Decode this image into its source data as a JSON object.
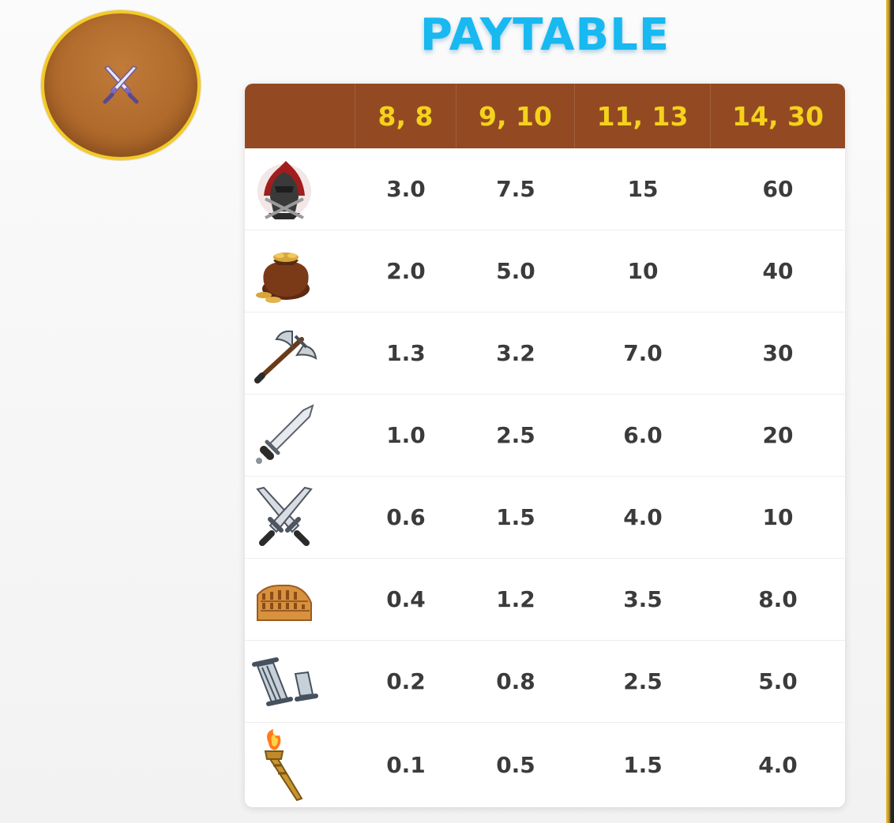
{
  "title": "PAYTABLE",
  "button": {
    "icon": "crossed-swords-icon"
  },
  "table": {
    "headers": [
      "8, 8",
      "9, 10",
      "11, 13",
      "14, 30"
    ],
    "rows": [
      {
        "symbol": "gladiator-helmet-icon",
        "values": [
          "3.0",
          "7.5",
          "15",
          "60"
        ]
      },
      {
        "symbol": "gold-coin-bag-icon",
        "values": [
          "2.0",
          "5.0",
          "10",
          "40"
        ]
      },
      {
        "symbol": "battle-axe-icon",
        "values": [
          "1.3",
          "3.2",
          "7.0",
          "30"
        ]
      },
      {
        "symbol": "sword-icon",
        "values": [
          "1.0",
          "2.5",
          "6.0",
          "20"
        ]
      },
      {
        "symbol": "crossed-swords-icon",
        "values": [
          "0.6",
          "1.5",
          "4.0",
          "10"
        ]
      },
      {
        "symbol": "colosseum-icon",
        "values": [
          "0.4",
          "1.2",
          "3.5",
          "8.0"
        ]
      },
      {
        "symbol": "broken-columns-icon",
        "values": [
          "0.2",
          "0.8",
          "2.5",
          "5.0"
        ]
      },
      {
        "symbol": "torch-icon",
        "values": [
          "0.1",
          "0.5",
          "1.5",
          "4.0"
        ]
      }
    ]
  },
  "colors": {
    "title": "#18b8f0",
    "header_bg": "#934a22",
    "header_text": "#f4d21c",
    "cell_text": "#3b3b3b",
    "button_bg": "#b06a2b",
    "button_border": "#f2cb26"
  }
}
